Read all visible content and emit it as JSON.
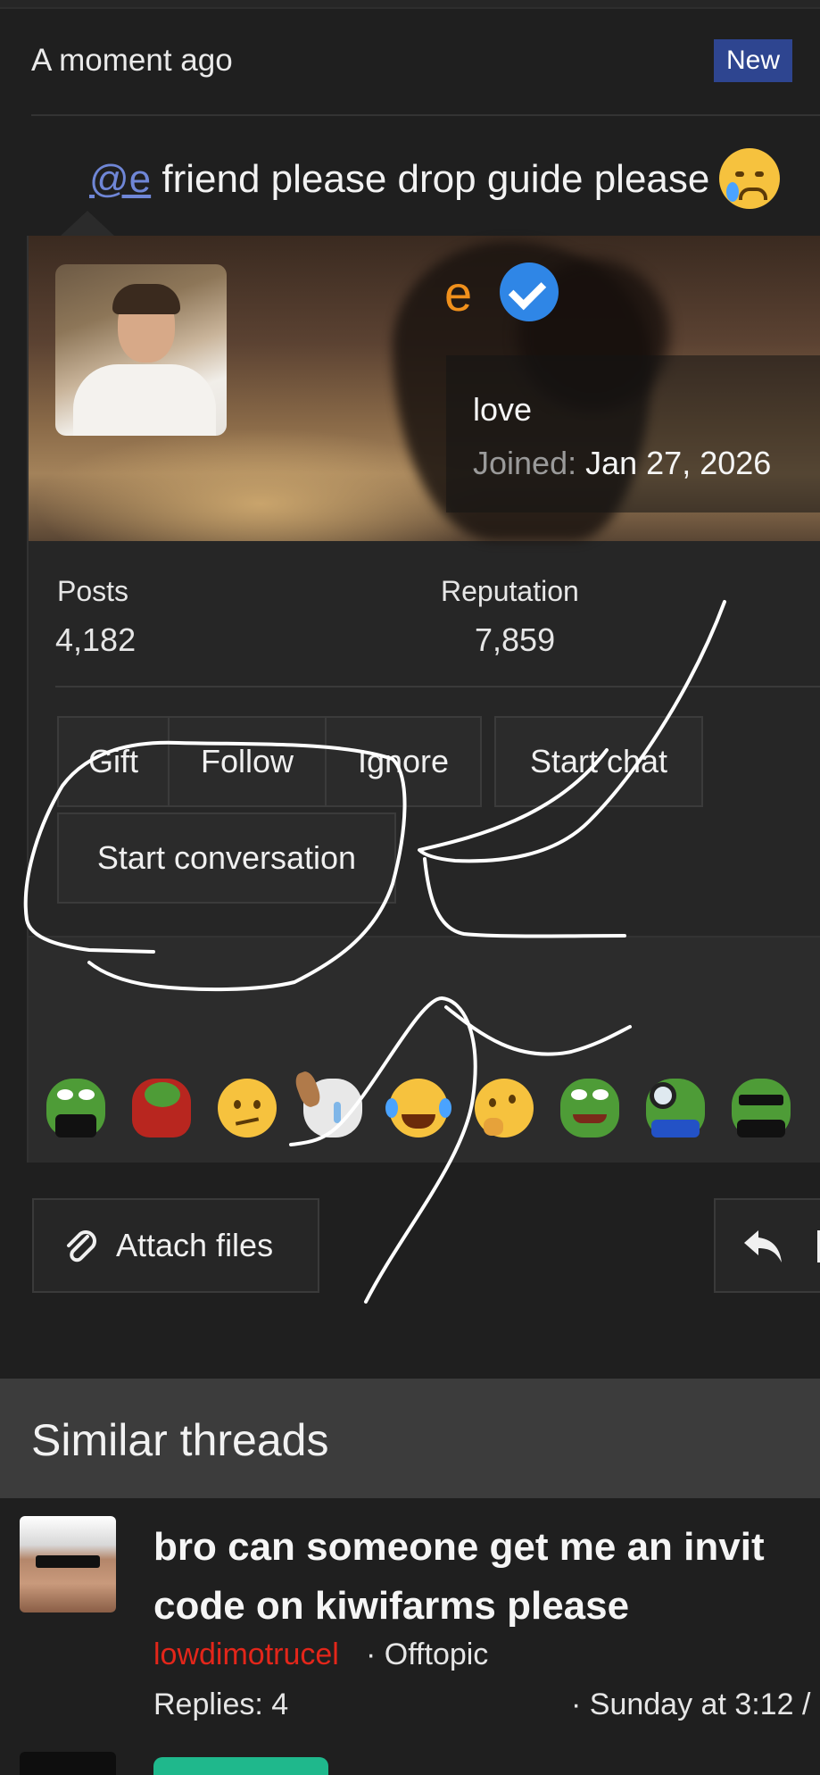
{
  "post": {
    "timestamp": "A moment ago",
    "new_badge": "New",
    "mention": "@e",
    "message": " friend please drop guide please",
    "message_emoji": "crying-face-icon"
  },
  "profile_card": {
    "username": "e",
    "verified_icon": "verified-check-icon",
    "title": "love",
    "joined_label": "Joined:",
    "joined_value": "Jan 27, 2026",
    "posts_label": "Posts",
    "posts_value": "4,182",
    "reputation_label": "Reputation",
    "reputation_value": "7,859",
    "actions": {
      "gift": "Gift",
      "follow": "Follow",
      "ignore": "Ignore",
      "start_chat": "Start chat",
      "start_conversation": "Start conversation"
    },
    "username_color": "#f0901c",
    "verified_color": "#2f86e6"
  },
  "reaction_emojis": [
    "pepe-suit-icon",
    "pepe-red-icon",
    "confused-face-icon",
    "crying-wojak-icon",
    "laughing-crying-face-icon",
    "thinking-face-icon",
    "pepe-smile-icon",
    "pepe-magnifier-icon",
    "pepe-sunglasses-icon"
  ],
  "composer": {
    "attach_label": "Attach files",
    "attach_icon": "paperclip-icon",
    "reply_icon": "reply-arrow-icon"
  },
  "similar_threads": {
    "header": "Similar threads",
    "items": [
      {
        "title_line1": "bro can someone get me an invit",
        "title_line2": "code on kiwifarms please",
        "author": "lowdimotrucel",
        "forum": "· Offtopic",
        "replies": "Replies: 4",
        "date": "· Sunday at 3:12 /"
      }
    ]
  },
  "colors": {
    "background": "#1f1f1f",
    "link": "#6f86d6",
    "new_badge": "#2e4590",
    "author_red": "#e3261a",
    "badge_green": "#1fb88c"
  }
}
